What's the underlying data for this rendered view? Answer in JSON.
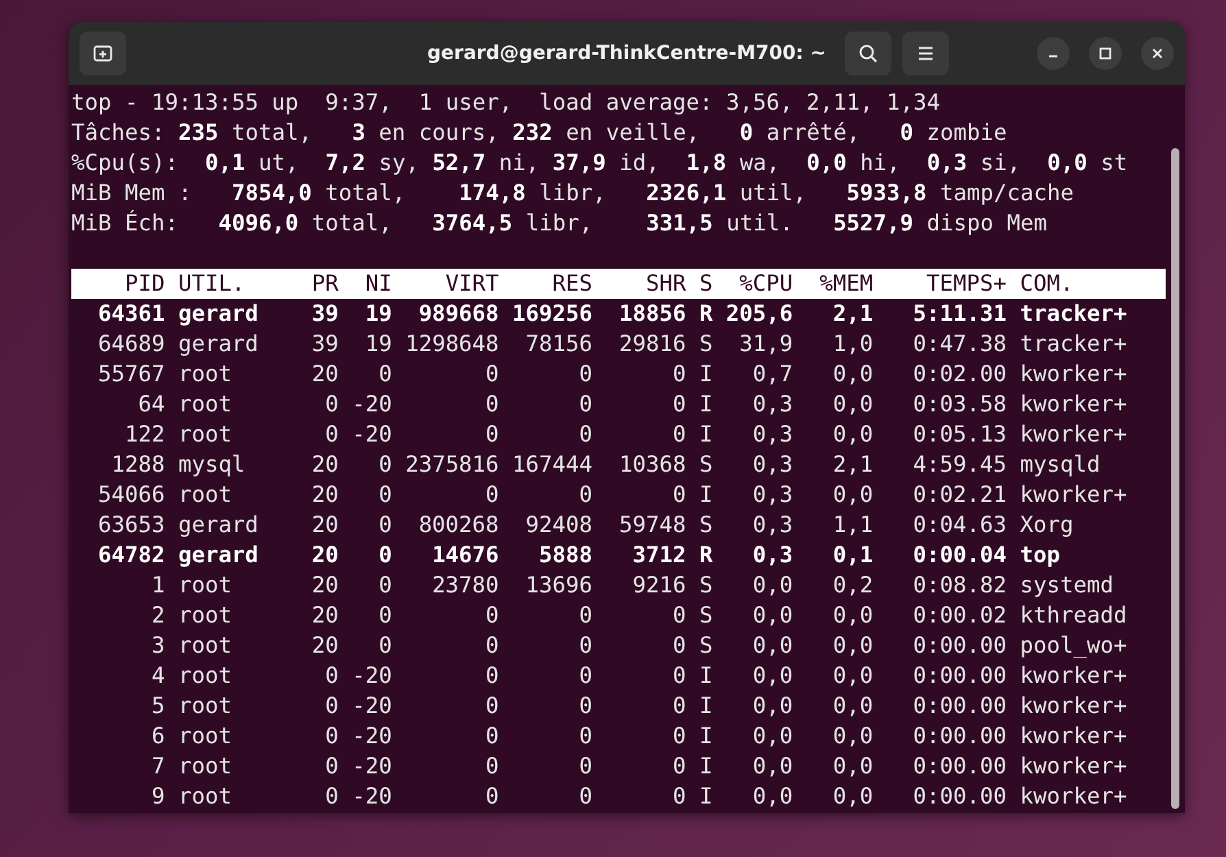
{
  "window": {
    "title": "gerard@gerard-ThinkCentre-M700: ~"
  },
  "summary": [
    "top - 19:13:55 up  9:37,  1 user,  load average: 3,56, 2,11, 1,34",
    "Tâches: **235** total,   **3** en cours, **232** en veille,   **0** arrêté,   **0** zombie",
    "%Cpu(s):  **0,1** ut,  **7,2** sy, **52,7** ni, **37,9** id,  **1,8** wa,  **0,0** hi,  **0,3** si,  **0,0** st",
    "MiB Mem :   **7854,0** total,    **174,8** libr,   **2326,1** util,   **5933,8** tamp/cache",
    "MiB Éch:   **4096,0** total,   **3764,5** libr,    **331,5** util.   **5527,9** dispo Mem"
  ],
  "table": {
    "columns": [
      "PID",
      "UTIL.",
      "PR",
      "NI",
      "VIRT",
      "RES",
      "SHR",
      "S",
      "%CPU",
      "%MEM",
      "TEMPS+",
      "COM."
    ],
    "rows": [
      {
        "running": true,
        "cells": [
          "64361",
          "gerard",
          "39",
          "19",
          "989668",
          "169256",
          "18856",
          "R",
          "205,6",
          "2,1",
          "5:11.31",
          "tracker+"
        ]
      },
      {
        "running": false,
        "cells": [
          "64689",
          "gerard",
          "39",
          "19",
          "1298648",
          "78156",
          "29816",
          "S",
          "31,9",
          "1,0",
          "0:47.38",
          "tracker+"
        ]
      },
      {
        "running": false,
        "cells": [
          "55767",
          "root",
          "20",
          "0",
          "0",
          "0",
          "0",
          "I",
          "0,7",
          "0,0",
          "0:02.00",
          "kworker+"
        ]
      },
      {
        "running": false,
        "cells": [
          "64",
          "root",
          "0",
          "-20",
          "0",
          "0",
          "0",
          "I",
          "0,3",
          "0,0",
          "0:03.58",
          "kworker+"
        ]
      },
      {
        "running": false,
        "cells": [
          "122",
          "root",
          "0",
          "-20",
          "0",
          "0",
          "0",
          "I",
          "0,3",
          "0,0",
          "0:05.13",
          "kworker+"
        ]
      },
      {
        "running": false,
        "cells": [
          "1288",
          "mysql",
          "20",
          "0",
          "2375816",
          "167444",
          "10368",
          "S",
          "0,3",
          "2,1",
          "4:59.45",
          "mysqld"
        ]
      },
      {
        "running": false,
        "cells": [
          "54066",
          "root",
          "20",
          "0",
          "0",
          "0",
          "0",
          "I",
          "0,3",
          "0,0",
          "0:02.21",
          "kworker+"
        ]
      },
      {
        "running": false,
        "cells": [
          "63653",
          "gerard",
          "20",
          "0",
          "800268",
          "92408",
          "59748",
          "S",
          "0,3",
          "1,1",
          "0:04.63",
          "Xorg"
        ]
      },
      {
        "running": true,
        "cells": [
          "64782",
          "gerard",
          "20",
          "0",
          "14676",
          "5888",
          "3712",
          "R",
          "0,3",
          "0,1",
          "0:00.04",
          "top"
        ]
      },
      {
        "running": false,
        "cells": [
          "1",
          "root",
          "20",
          "0",
          "23780",
          "13696",
          "9216",
          "S",
          "0,0",
          "0,2",
          "0:08.82",
          "systemd"
        ]
      },
      {
        "running": false,
        "cells": [
          "2",
          "root",
          "20",
          "0",
          "0",
          "0",
          "0",
          "S",
          "0,0",
          "0,0",
          "0:00.02",
          "kthreadd"
        ]
      },
      {
        "running": false,
        "cells": [
          "3",
          "root",
          "20",
          "0",
          "0",
          "0",
          "0",
          "S",
          "0,0",
          "0,0",
          "0:00.00",
          "pool_wo+"
        ]
      },
      {
        "running": false,
        "cells": [
          "4",
          "root",
          "0",
          "-20",
          "0",
          "0",
          "0",
          "I",
          "0,0",
          "0,0",
          "0:00.00",
          "kworker+"
        ]
      },
      {
        "running": false,
        "cells": [
          "5",
          "root",
          "0",
          "-20",
          "0",
          "0",
          "0",
          "I",
          "0,0",
          "0,0",
          "0:00.00",
          "kworker+"
        ]
      },
      {
        "running": false,
        "cells": [
          "6",
          "root",
          "0",
          "-20",
          "0",
          "0",
          "0",
          "I",
          "0,0",
          "0,0",
          "0:00.00",
          "kworker+"
        ]
      },
      {
        "running": false,
        "cells": [
          "7",
          "root",
          "0",
          "-20",
          "0",
          "0",
          "0",
          "I",
          "0,0",
          "0,0",
          "0:00.00",
          "kworker+"
        ]
      },
      {
        "running": false,
        "cells": [
          "9",
          "root",
          "0",
          "-20",
          "0",
          "0",
          "0",
          "I",
          "0,0",
          "0,0",
          "0:00.00",
          "kworker+"
        ]
      }
    ]
  }
}
